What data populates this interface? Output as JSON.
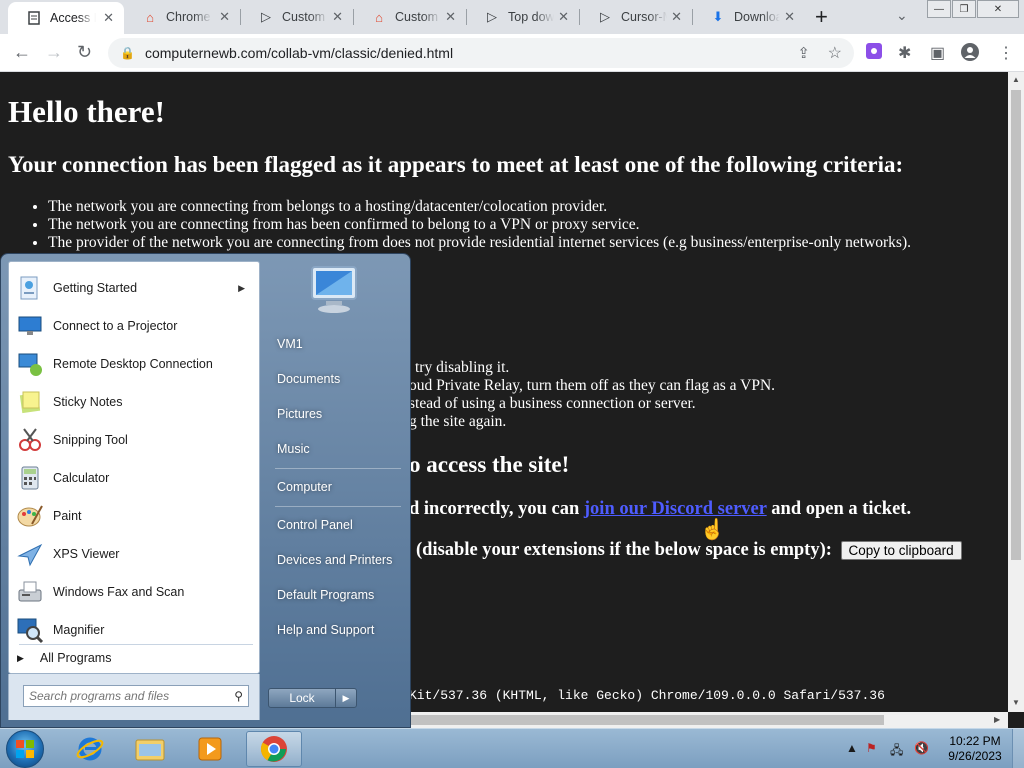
{
  "browser": {
    "tabs": [
      {
        "title": "Access Denied",
        "icon": "page-icon",
        "active": true
      },
      {
        "title": "Chrome Web Store",
        "icon": "chrome-store-icon"
      },
      {
        "title": "Custom Cursor",
        "icon": "cursor-icon"
      },
      {
        "title": "Custom Cursor",
        "icon": "chrome-store-icon"
      },
      {
        "title": "Top downloads",
        "icon": "cursor-icon"
      },
      {
        "title": "Cursor-Mania",
        "icon": "cursor-icon"
      },
      {
        "title": "Downloads",
        "icon": "download-icon"
      }
    ],
    "url": "computernewb.com/collab-vm/classic/denied.html"
  },
  "page": {
    "heading": "Hello there!",
    "subheading": "Your connection has been flagged as it appears to meet at least one of the following criteria:",
    "criteria": [
      "The network you are connecting from belongs to a hosting/datacenter/colocation provider.",
      "The network you are connecting from has been confirmed to belong to a VPN or proxy service.",
      "The provider of the network you are connecting from does not provide residential internet services (e.g business/enterprise-only networks)."
    ],
    "partial_lines": [
      "try disabling it.",
      "oud Private Relay, turn them off as they can flag as a VPN.",
      "stead of using a business connection or server.",
      "g the site again."
    ],
    "partial_heading": "o access the site!",
    "ticket_prefix": "d incorrectly, you can",
    "ticket_link": "join our Discord server",
    "ticket_suffix": "and open a ticket.",
    "extensions_text": "(disable your extensions if the below space is empty):",
    "copy_button": "Copy to clipboard",
    "user_agent": "Kit/537.36 (KHTML, like Gecko) Chrome/109.0.0.0 Safari/537.36"
  },
  "start_menu": {
    "programs": [
      {
        "label": "Getting Started",
        "icon": "getting-started-icon",
        "submenu": true
      },
      {
        "label": "Connect to a Projector",
        "icon": "projector-icon"
      },
      {
        "label": "Remote Desktop Connection",
        "icon": "remote-desktop-icon"
      },
      {
        "label": "Sticky Notes",
        "icon": "sticky-notes-icon"
      },
      {
        "label": "Snipping Tool",
        "icon": "snipping-tool-icon"
      },
      {
        "label": "Calculator",
        "icon": "calculator-icon"
      },
      {
        "label": "Paint",
        "icon": "paint-icon"
      },
      {
        "label": "XPS Viewer",
        "icon": "xps-viewer-icon"
      },
      {
        "label": "Windows Fax and Scan",
        "icon": "fax-scan-icon"
      },
      {
        "label": "Magnifier",
        "icon": "magnifier-icon"
      }
    ],
    "all_programs": "All Programs",
    "search_placeholder": "Search programs and files",
    "right_items": [
      "VM1",
      "Documents",
      "Pictures",
      "Music",
      "Computer",
      "Control Panel",
      "Devices and Printers",
      "Default Programs",
      "Help and Support"
    ],
    "lock_label": "Lock"
  },
  "taskbar": {
    "time": "10:22 PM",
    "date": "9/26/2023"
  }
}
